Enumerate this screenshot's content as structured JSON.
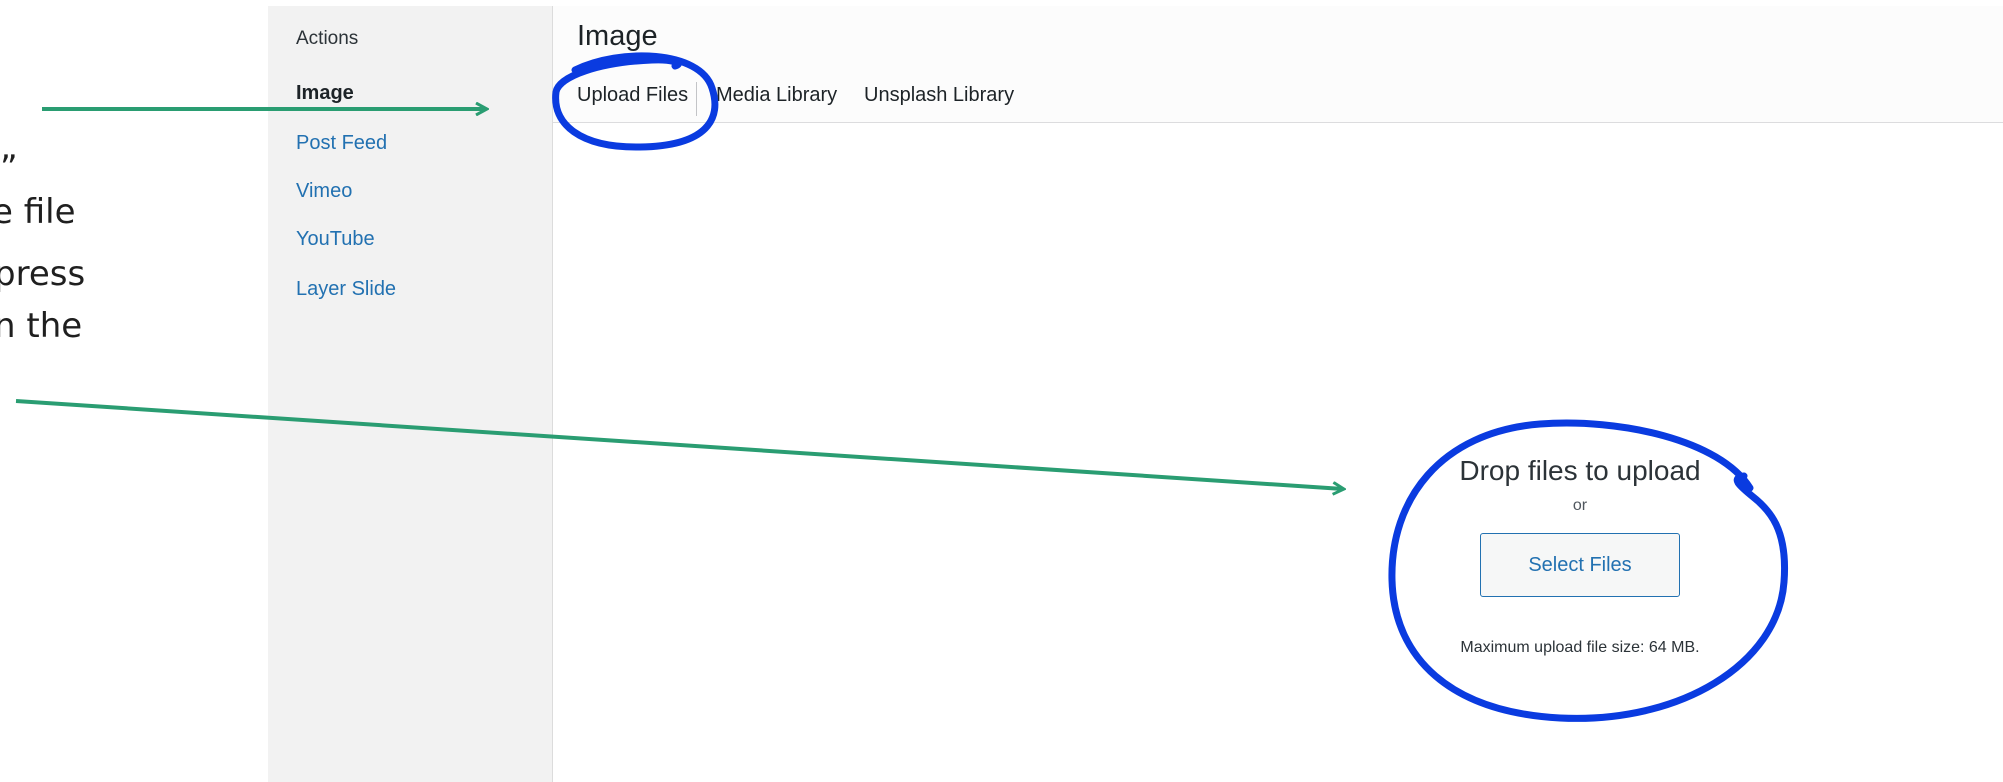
{
  "annotation": {
    "lines": [
      "”",
      "e file",
      "press",
      "n the"
    ]
  },
  "sidebar": {
    "heading": "Actions",
    "items": [
      {
        "label": "Image",
        "active": true
      },
      {
        "label": "Post Feed"
      },
      {
        "label": "Vimeo"
      },
      {
        "label": "YouTube"
      },
      {
        "label": "Layer Slide"
      }
    ]
  },
  "frame": {
    "title": "Image",
    "tabs": [
      {
        "label": "Upload Files",
        "active": true
      },
      {
        "label": "Media Library"
      },
      {
        "label": "Unsplash Library"
      }
    ]
  },
  "uploader": {
    "drop_text": "Drop files to upload",
    "or_text": "or",
    "select_button": "Select Files",
    "max_size": "Maximum upload file size: 64 MB."
  },
  "colors": {
    "arrow": "#2a9d72",
    "circle": "#0a3be0",
    "link": "#2271b1"
  }
}
